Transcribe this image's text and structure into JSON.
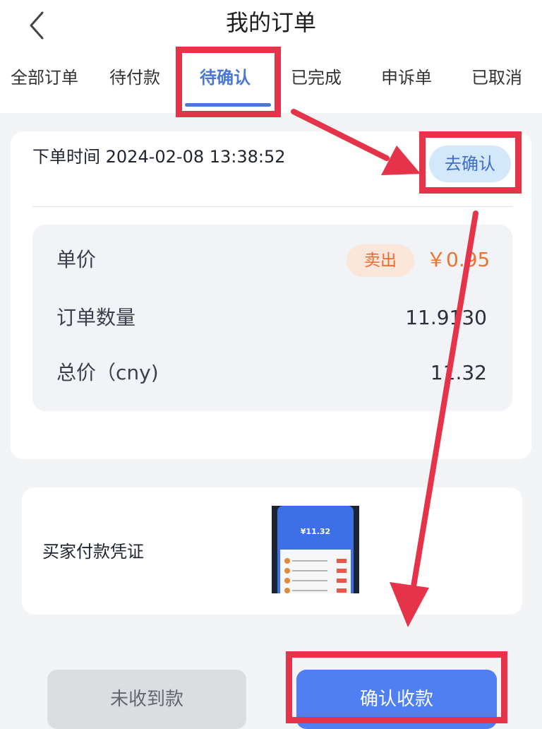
{
  "header": {
    "title": "我的订单"
  },
  "tabs": [
    {
      "label": "全部订单"
    },
    {
      "label": "待付款"
    },
    {
      "label": "待确认"
    },
    {
      "label": "已完成"
    },
    {
      "label": "申诉单"
    },
    {
      "label": "已取消"
    }
  ],
  "active_tab": "待确认",
  "order": {
    "time_label": "下单时间",
    "time_value": "2024-02-08 13:38:52",
    "confirm_button": "去确认",
    "unit_price_label": "单价",
    "side_badge": "卖出",
    "unit_price_value": "￥0.95",
    "quantity_label": "订单数量",
    "quantity_value": "11.9130",
    "total_label": "总价（cny)",
    "total_value": "11.32"
  },
  "proof": {
    "label": "买家付款凭证",
    "thumbnail_amount": "¥11.32"
  },
  "actions": {
    "not_received": "未收到款",
    "confirm_received": "确认收款"
  },
  "colors": {
    "accent_blue": "#4a78d8",
    "annotation_red": "#e5344a",
    "price_orange": "#ed7430",
    "button_blue": "#4f7ff0"
  }
}
